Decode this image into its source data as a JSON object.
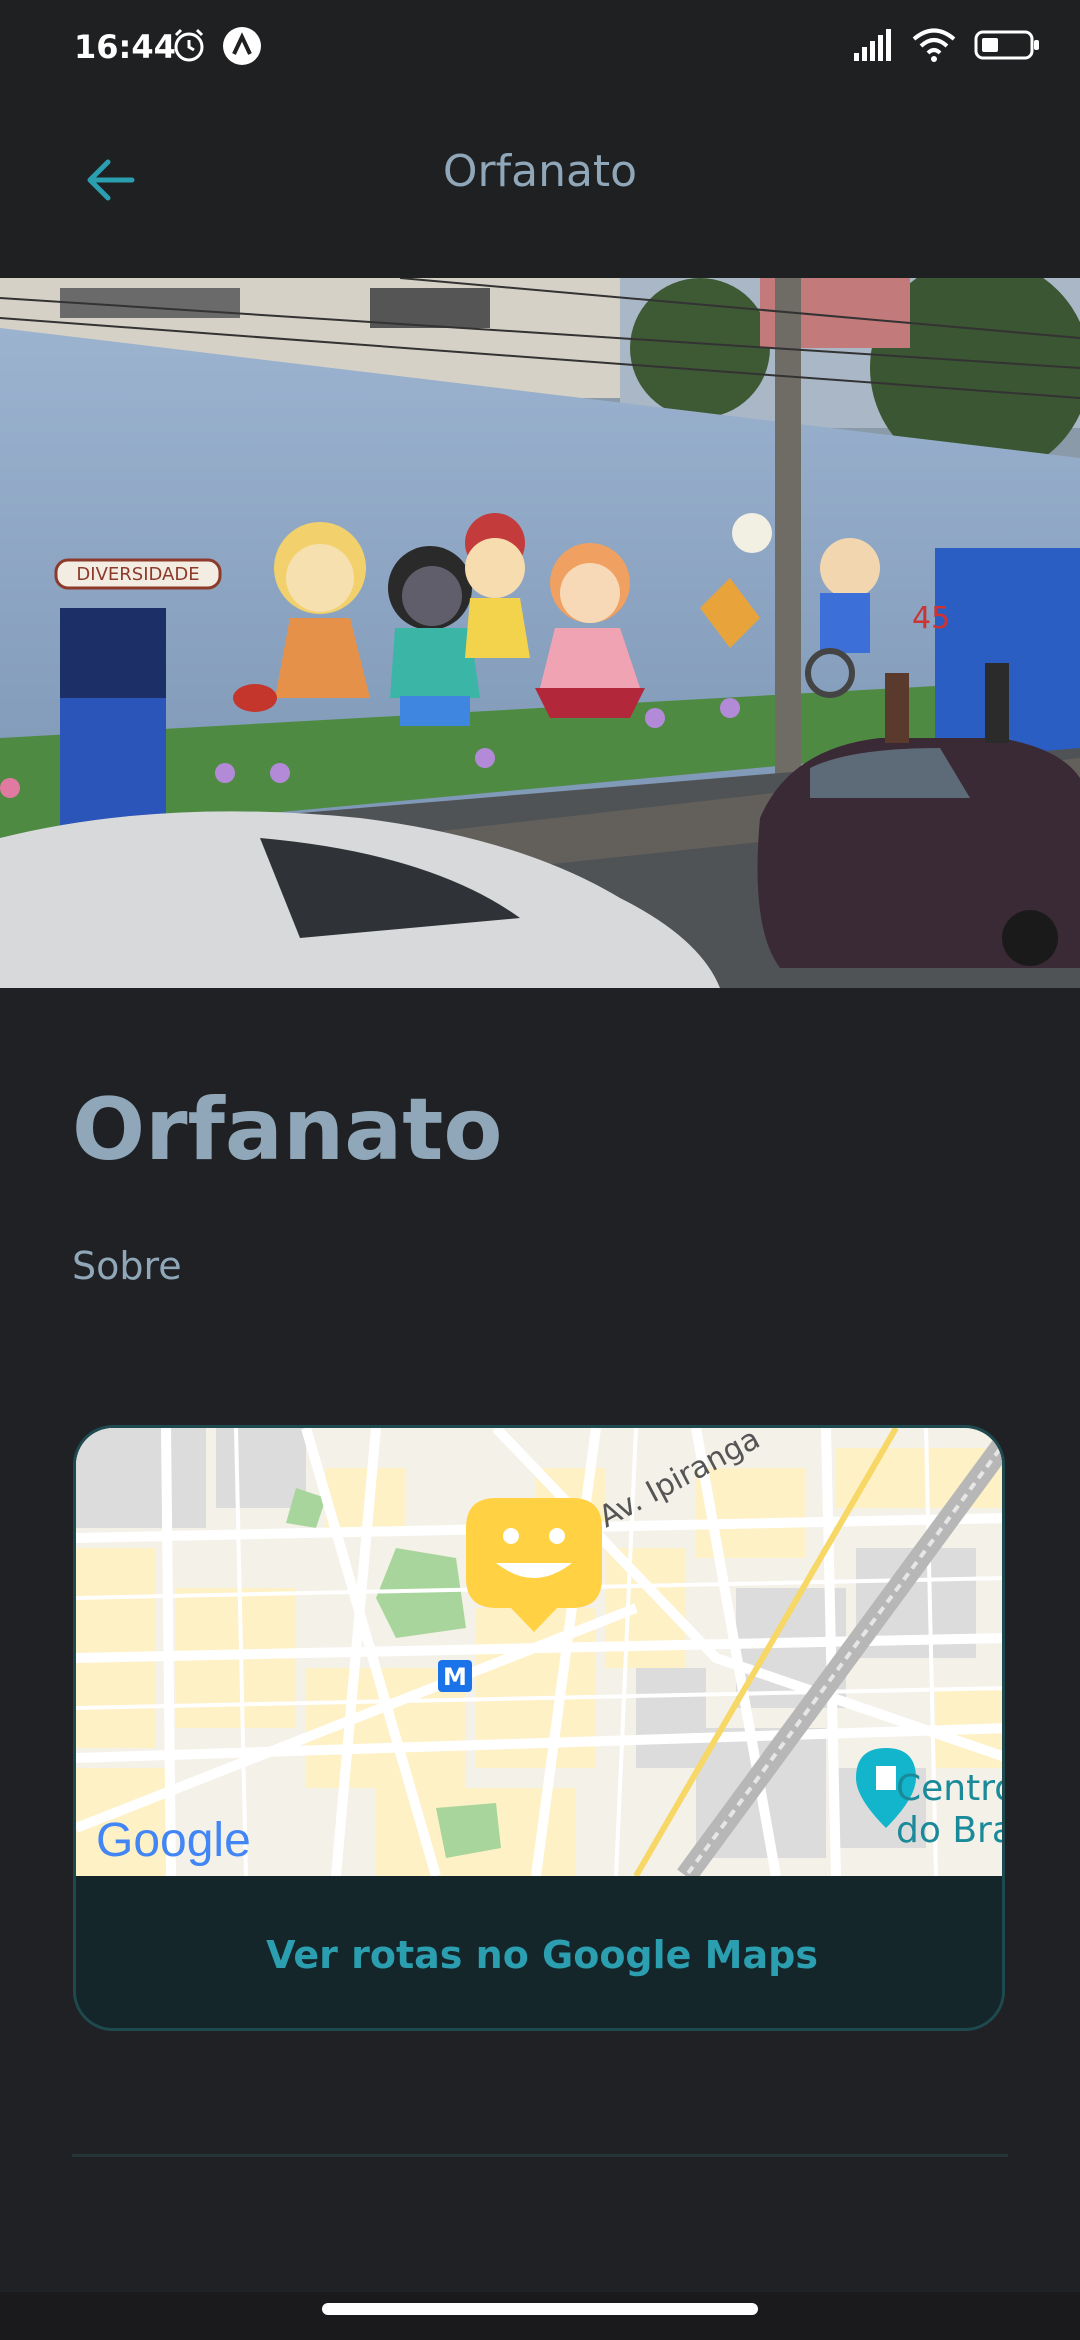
{
  "status": {
    "time": "16:44"
  },
  "header": {
    "title": "Orfanato"
  },
  "hero": {
    "mural_banner": "DIVERSIDADE",
    "number": "45"
  },
  "content": {
    "title": "Orfanato",
    "about_label": "Sobre"
  },
  "map": {
    "street_label": "Av. Ipiranga",
    "poi_label_line1": "Centro",
    "poi_label_line2": "do Bra",
    "metro_label": "M",
    "logo_text": "Google",
    "routes_button": "Ver rotas no Google Maps"
  },
  "colors": {
    "accent": "#2b9fb0",
    "title": "#8fa7b8",
    "marker": "#ffd143",
    "background": "#202124"
  }
}
